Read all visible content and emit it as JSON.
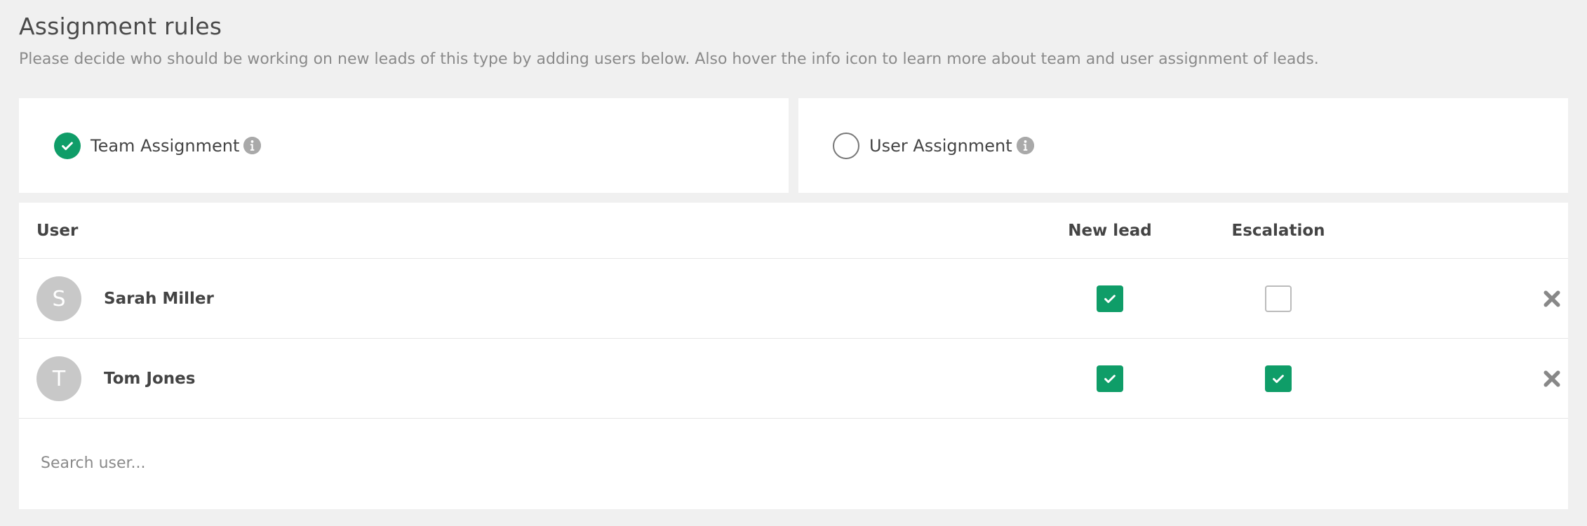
{
  "header": {
    "title": "Assignment rules",
    "description": "Please decide who should be working on new leads of this type by adding users below. Also hover the info icon to learn more about team and user assignment of leads."
  },
  "assignment": {
    "team": {
      "label": "Team Assignment",
      "selected": true
    },
    "user": {
      "label": "User Assignment",
      "selected": false
    }
  },
  "table": {
    "columns": {
      "user": "User",
      "new_lead": "New lead",
      "escalation": "Escalation"
    },
    "rows": [
      {
        "initial": "S",
        "name": "Sarah Miller",
        "new_lead": true,
        "escalation": false
      },
      {
        "initial": "T",
        "name": "Tom Jones",
        "new_lead": true,
        "escalation": true
      }
    ]
  },
  "search": {
    "placeholder": "Search user...",
    "value": ""
  },
  "colors": {
    "accent": "#0f9d68",
    "page_background": "#f0f0f0",
    "avatar": "#c8c8c8",
    "icon_grey": "#a9a9a9"
  },
  "icons": {
    "selected": "check-icon",
    "info": "info-icon",
    "remove": "close-icon"
  }
}
